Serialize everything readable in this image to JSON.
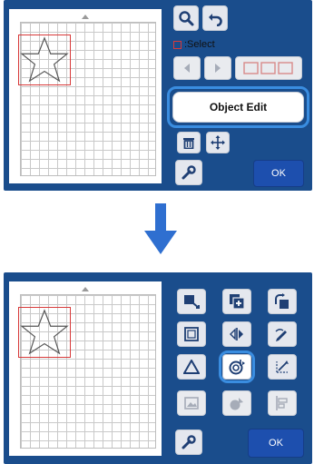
{
  "top": {
    "select_label": ":Select",
    "object_edit_label": "Object Edit",
    "ok_label": "OK"
  },
  "bottom": {
    "ok_label": "OK"
  },
  "colors": {
    "screen_bg": "#1a4d8c",
    "highlight": "#3a8de0",
    "selection": "#d83a3a",
    "ok_bg": "#1d4fae",
    "arrow": "#2f6fd0"
  },
  "icons": {
    "top_row1": [
      "zoom-icon",
      "undo-icon"
    ],
    "top_row3": [
      "prev-arrow-icon",
      "next-arrow-icon",
      "select-all-icon"
    ],
    "top_row5": [
      "trash-icon",
      "move-icon"
    ],
    "top_settings": "wrench-icon",
    "bottom_grid": [
      [
        "resize-icon",
        "duplicate-icon",
        "rotate-icon"
      ],
      [
        "frame-icon",
        "mirror-icon",
        "edit-icon"
      ],
      [
        "shape-icon",
        "outline-icon",
        "distance-icon"
      ],
      [
        "image-icon",
        "fill-icon",
        "align-icon"
      ]
    ],
    "bottom_settings": "wrench-icon"
  }
}
